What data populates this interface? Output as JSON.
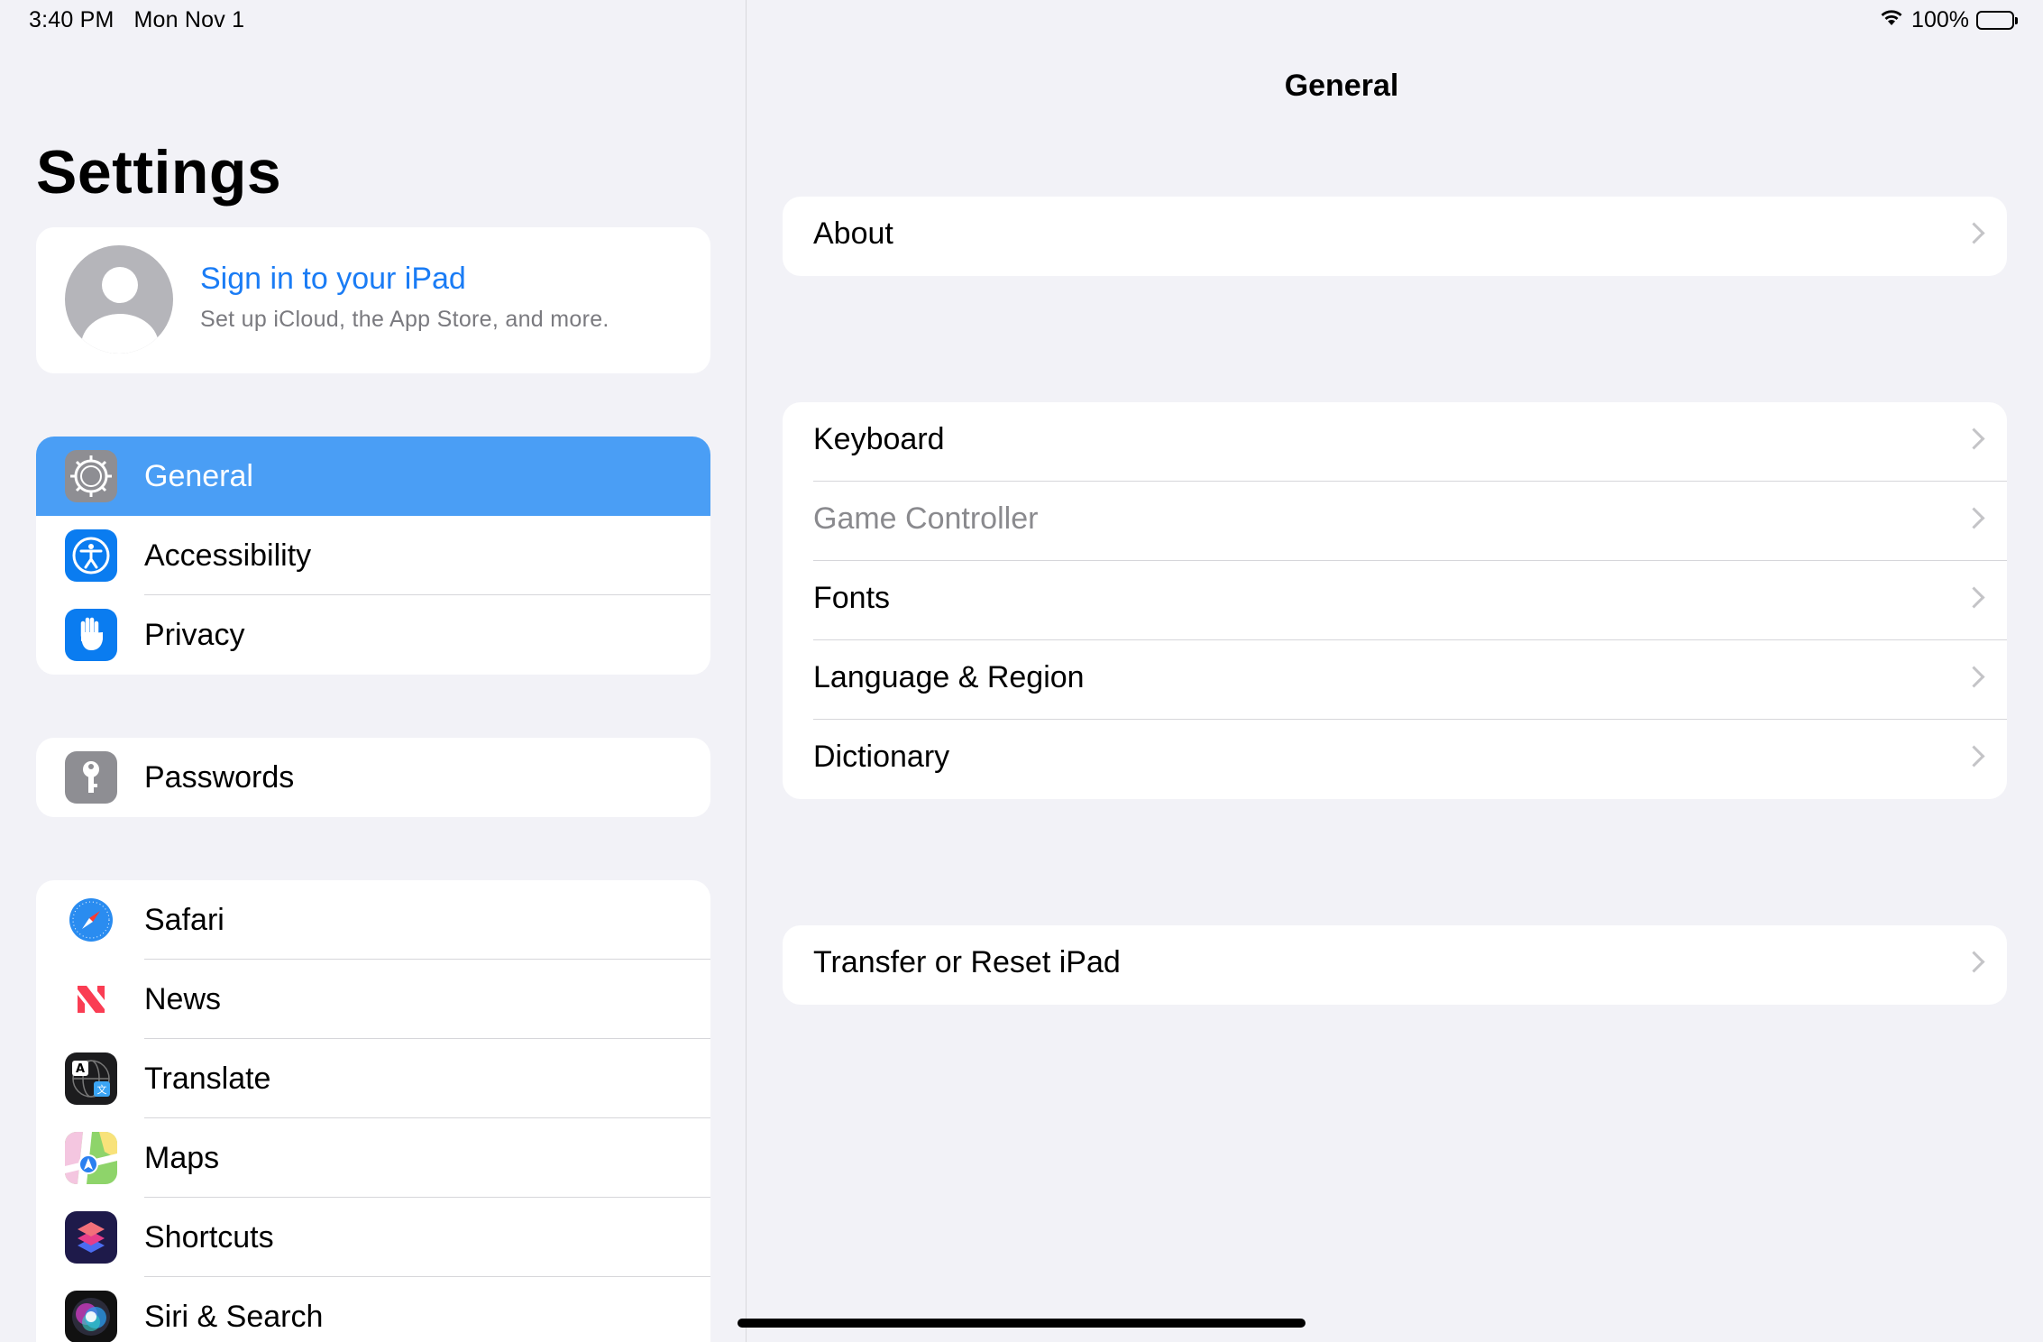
{
  "status_bar": {
    "time": "3:40 PM",
    "date": "Mon Nov 1",
    "battery_pct": "100%",
    "wifi_icon": "wifi-icon",
    "battery_icon": "battery-icon"
  },
  "sidebar": {
    "title": "Settings",
    "account": {
      "title": "Sign in to your iPad",
      "subtitle": "Set up iCloud, the App Store, and more."
    },
    "groups": [
      [
        {
          "label": "General",
          "icon": "gear-icon",
          "selected": true
        },
        {
          "label": "Accessibility",
          "icon": "accessibility-icon"
        },
        {
          "label": "Privacy",
          "icon": "hand-icon"
        }
      ],
      [
        {
          "label": "Passwords",
          "icon": "key-icon"
        }
      ],
      [
        {
          "label": "Safari",
          "icon": "safari-icon"
        },
        {
          "label": "News",
          "icon": "news-icon"
        },
        {
          "label": "Translate",
          "icon": "translate-icon"
        },
        {
          "label": "Maps",
          "icon": "maps-icon"
        },
        {
          "label": "Shortcuts",
          "icon": "shortcuts-icon"
        },
        {
          "label": "Siri & Search",
          "icon": "siri-icon"
        }
      ]
    ]
  },
  "detail": {
    "title": "General",
    "groups": [
      [
        {
          "label": "About"
        }
      ],
      [
        {
          "label": "Keyboard"
        },
        {
          "label": "Game Controller",
          "dimmed": true
        },
        {
          "label": "Fonts"
        },
        {
          "label": "Language & Region"
        },
        {
          "label": "Dictionary"
        }
      ],
      [
        {
          "label": "Transfer or Reset iPad"
        }
      ]
    ]
  },
  "colors": {
    "accent": "#1a7cf5",
    "selected_row": "#4a9ef5",
    "background": "#f2f2f7"
  }
}
